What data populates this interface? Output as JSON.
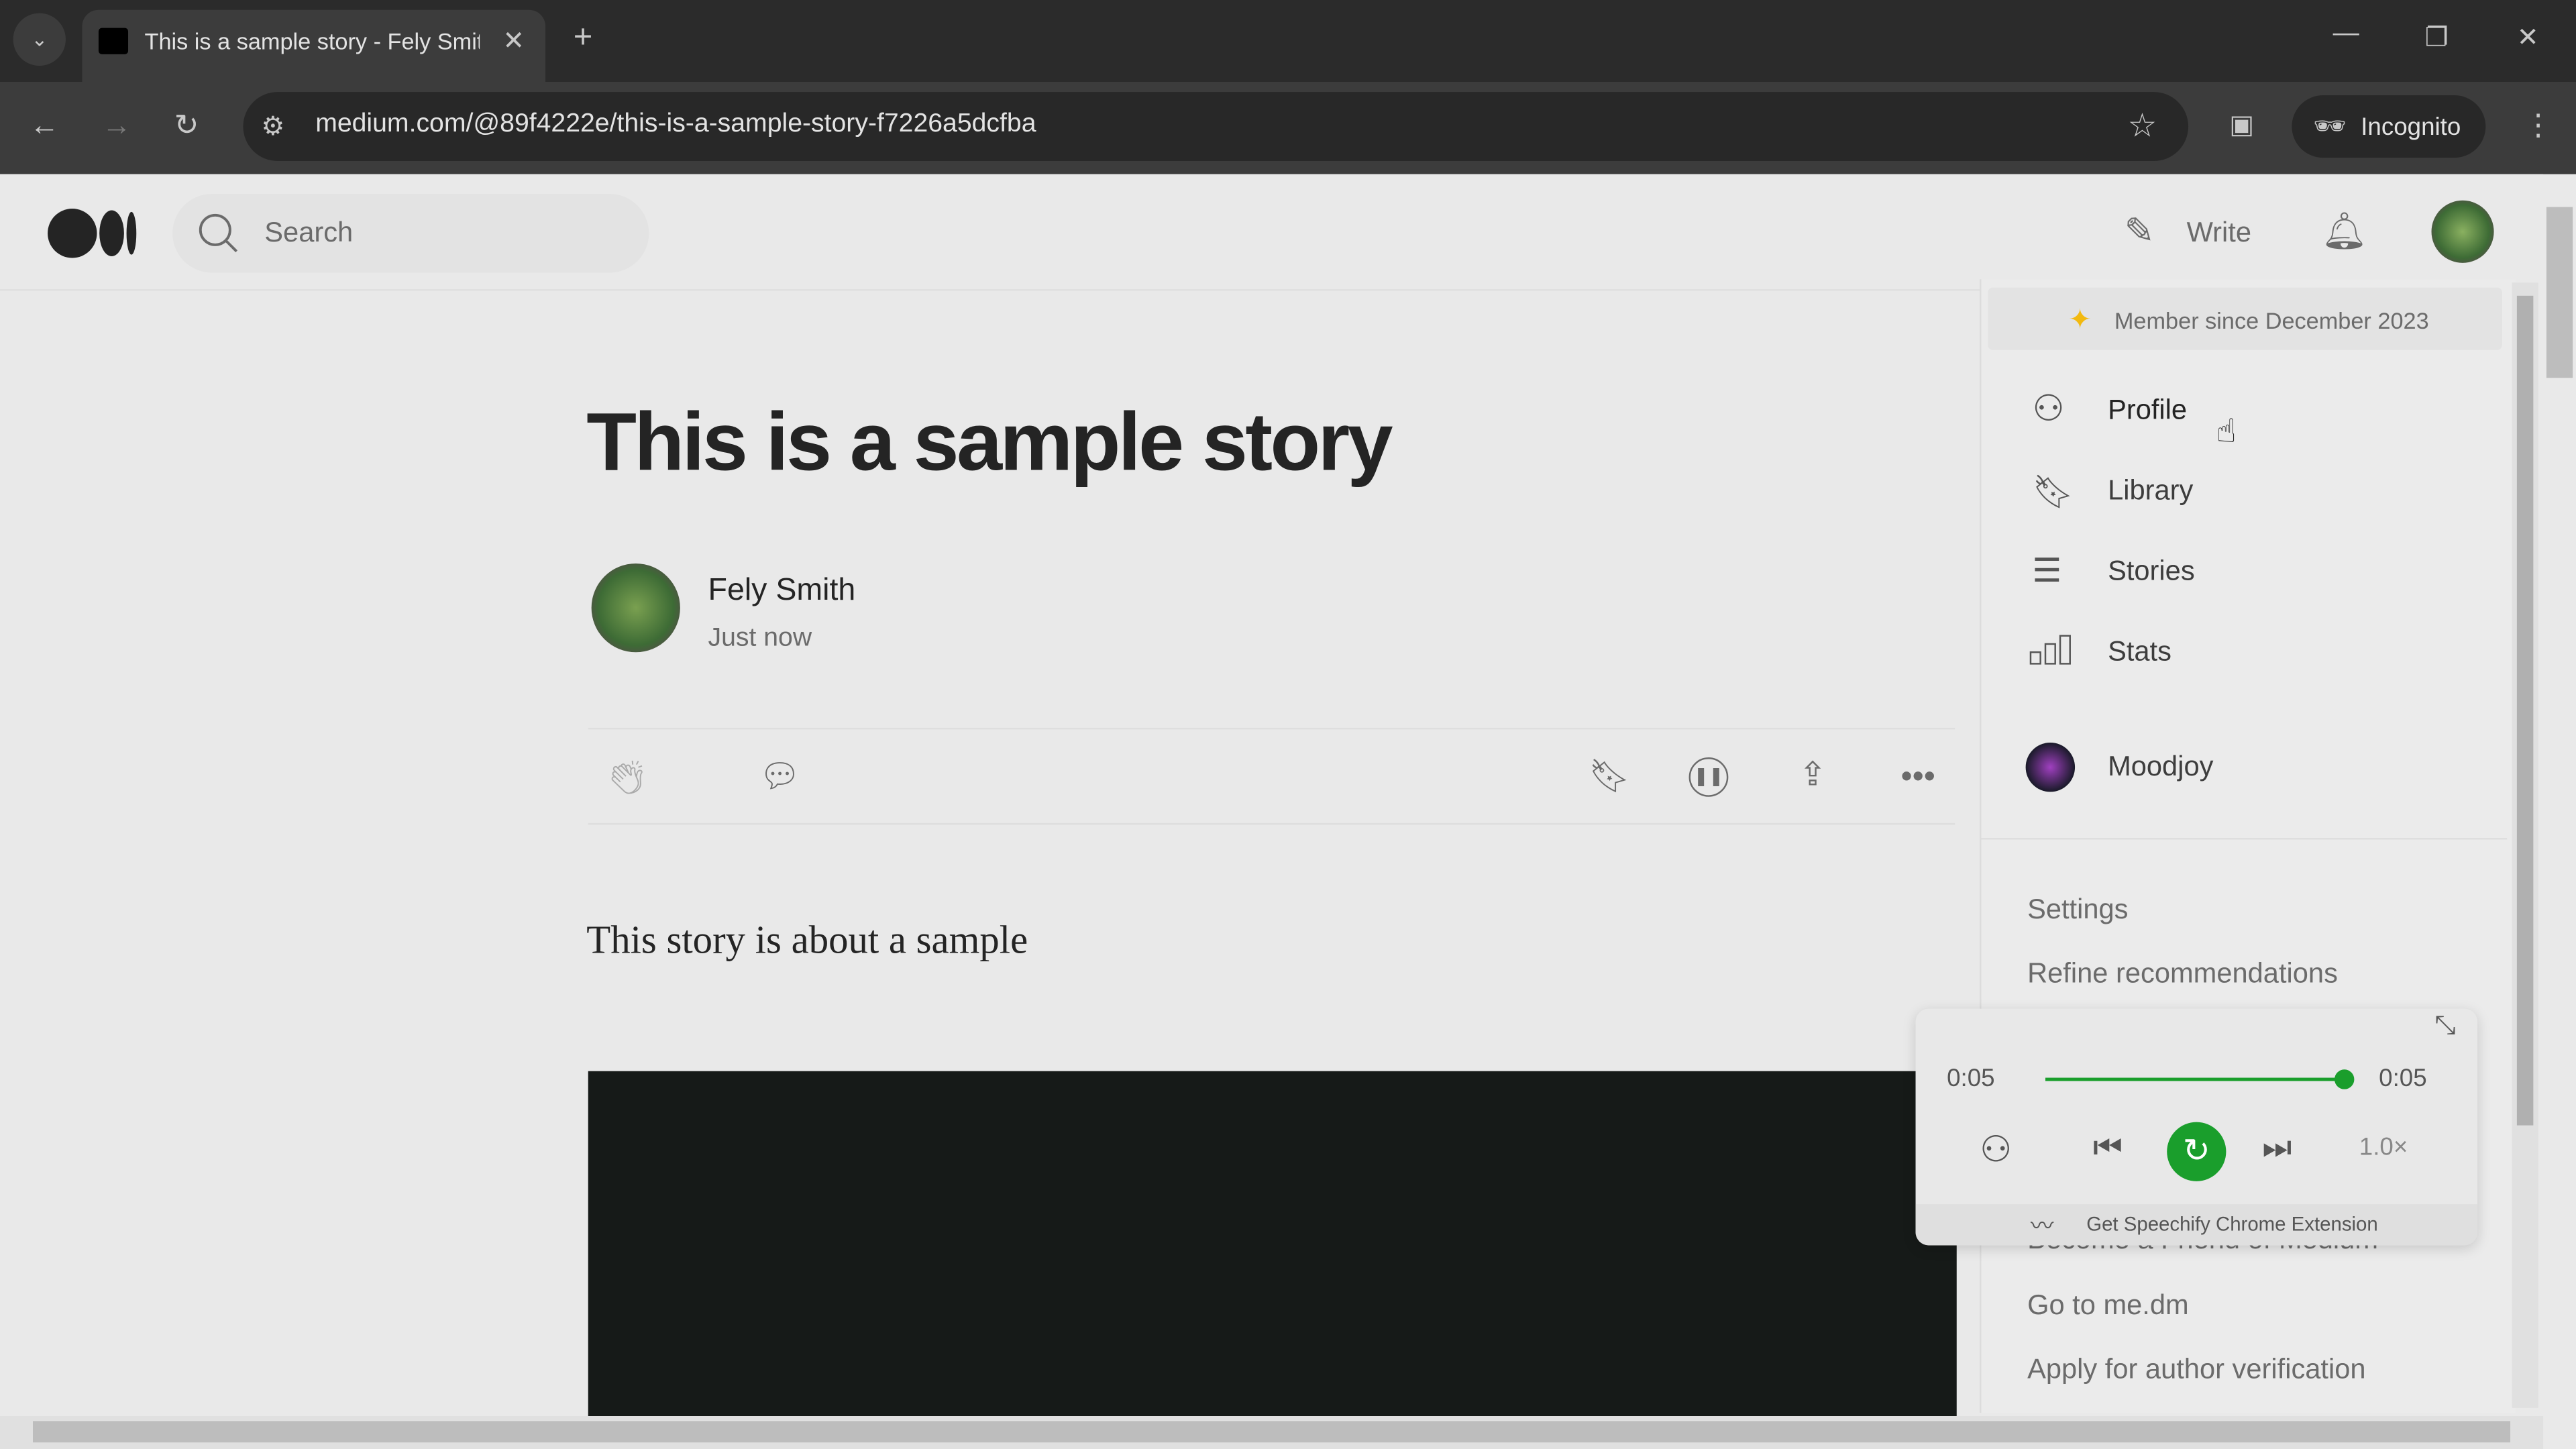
{
  "browser": {
    "tab_title": "This is a sample story - Fely Smith",
    "url": "medium.com/@89f4222e/this-is-a-sample-story-f7226a5dcfba",
    "incognito_label": "Incognito"
  },
  "header": {
    "search_placeholder": "Search",
    "write_label": "Write"
  },
  "story": {
    "title": "This is a sample story",
    "author": "Fely Smith",
    "time": "Just now",
    "body": "This story is about a sample"
  },
  "menu": {
    "member_since": "Member since December 2023",
    "items": [
      {
        "label": "Profile",
        "icon": "person-icon"
      },
      {
        "label": "Library",
        "icon": "bookmark-icon"
      },
      {
        "label": "Stories",
        "icon": "document-icon"
      },
      {
        "label": "Stats",
        "icon": "bar-chart-icon"
      }
    ],
    "publication": "Moodjoy",
    "links": [
      "Settings",
      "Refine recommendations",
      "Become a Friend of Medium",
      "Go to me.dm",
      "Apply for author verification"
    ]
  },
  "player": {
    "elapsed": "0:05",
    "total": "0:05",
    "progress": 1.0,
    "speed": "1.0×",
    "promo": "Get Speechify Chrome Extension",
    "accent": "#1a9e2c"
  },
  "colors": {
    "member_star": "#f2b90f"
  }
}
